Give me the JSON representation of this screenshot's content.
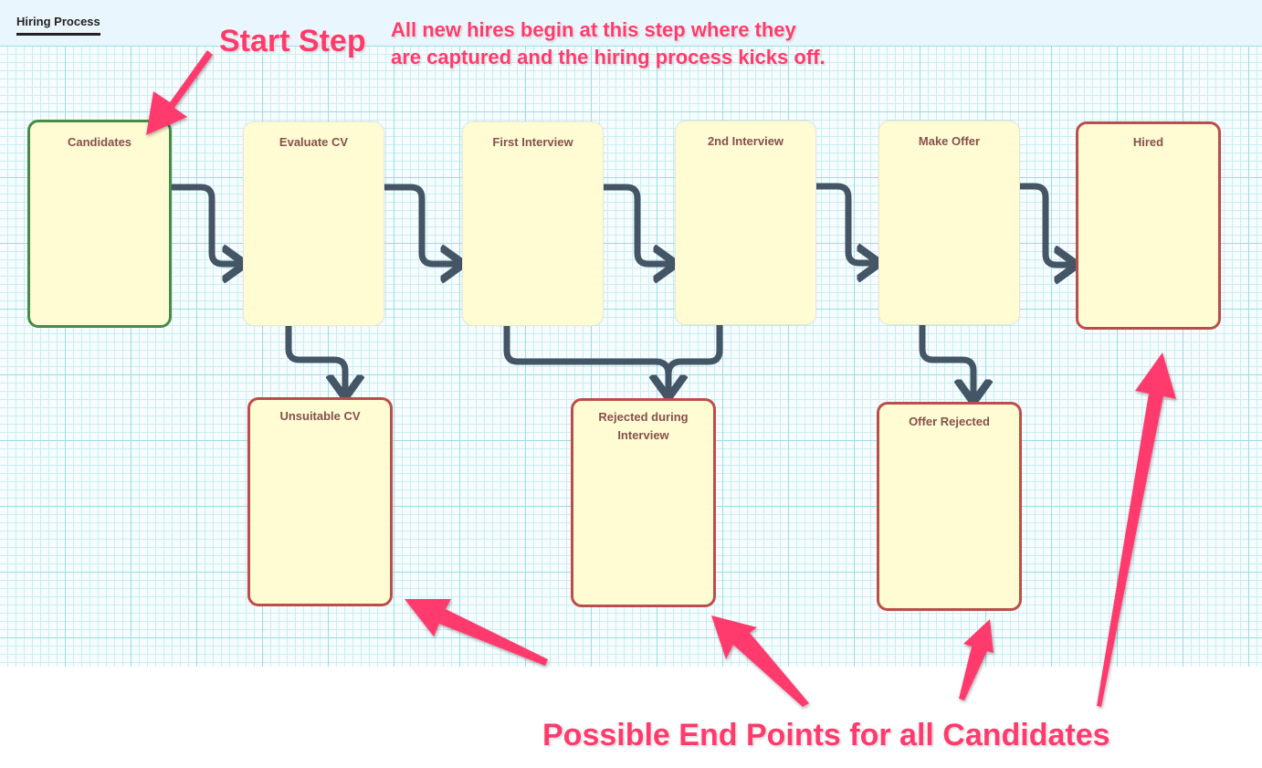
{
  "header": {
    "tab_label": "Hiring Process"
  },
  "colors": {
    "connector": "#445566",
    "start_border": "#4a8a47",
    "end_border": "#bd4d4a",
    "node_fill": "#fffcd3",
    "annotation": "#ff3b6e"
  },
  "nodes": {
    "candidates": {
      "label": "Candidates",
      "type": "start"
    },
    "evaluate_cv": {
      "label": "Evaluate CV",
      "type": "step"
    },
    "first_interview": {
      "label": "First Interview",
      "type": "step"
    },
    "second_interview": {
      "label": "2nd Interview",
      "type": "step"
    },
    "make_offer": {
      "label": "Make Offer",
      "type": "step"
    },
    "hired": {
      "label": "Hired",
      "type": "end"
    },
    "unsuitable_cv": {
      "label": "Unsuitable CV",
      "type": "end"
    },
    "rejected_interview": {
      "label": "Rejected during Interview",
      "type": "end"
    },
    "offer_rejected": {
      "label": "Offer Rejected",
      "type": "end"
    }
  },
  "edges": [
    {
      "from": "Candidates",
      "to": "Evaluate CV"
    },
    {
      "from": "Evaluate CV",
      "to": "First Interview"
    },
    {
      "from": "First Interview",
      "to": "2nd Interview"
    },
    {
      "from": "2nd Interview",
      "to": "Make Offer"
    },
    {
      "from": "Make Offer",
      "to": "Hired"
    },
    {
      "from": "Evaluate CV",
      "to": "Unsuitable CV"
    },
    {
      "from": "First Interview",
      "to": "Rejected during Interview"
    },
    {
      "from": "2nd Interview",
      "to": "Rejected during Interview"
    },
    {
      "from": "Make Offer",
      "to": "Offer Rejected"
    }
  ],
  "annotations": {
    "start_title": "Start Step",
    "start_desc_line1": "All new hires begin at this step where they",
    "start_desc_line2": "are captured and the hiring process kicks off.",
    "end_points": "Possible End Points for all Candidates"
  }
}
